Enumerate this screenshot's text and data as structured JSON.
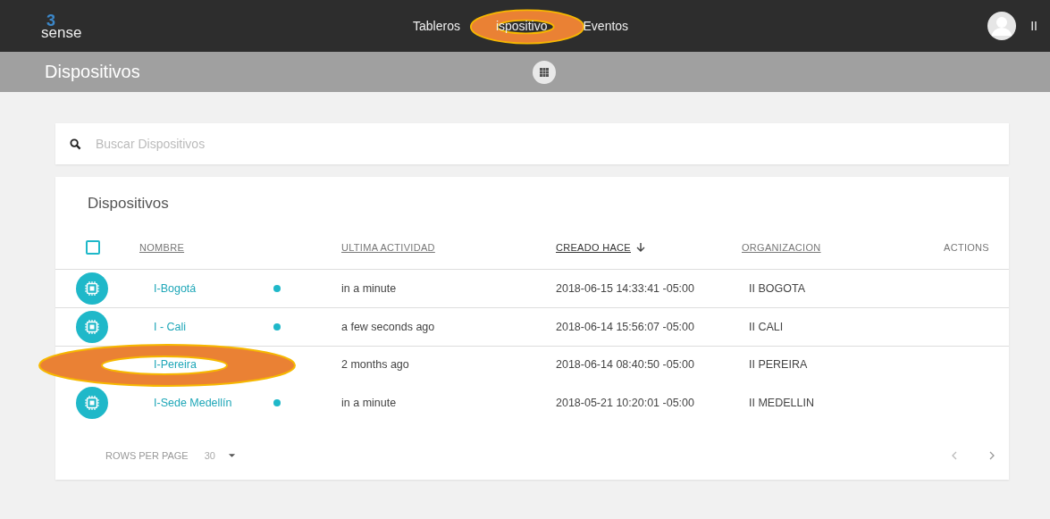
{
  "brand": {
    "logo_mark": "3",
    "logo_text": "sense"
  },
  "nav": [
    {
      "label": "Tableros",
      "annotated": false
    },
    {
      "label": "ispositivo",
      "annotated": true
    },
    {
      "label": "Eventos",
      "annotated": false
    }
  ],
  "user": {
    "name": "II"
  },
  "page_title": "Dispositivos",
  "search": {
    "placeholder": "Buscar Dispositivos"
  },
  "table": {
    "title": "Dispositivos",
    "select_all": false,
    "columns": [
      {
        "label": "NOMBRE",
        "sorted": false
      },
      {
        "label": "ULTIMA ACTIVIDAD",
        "sorted": false
      },
      {
        "label": "CREADO HACE",
        "sorted": true
      },
      {
        "label": "ORGANIZACION",
        "sorted": false
      },
      {
        "label": "ACTIONS",
        "sorted": false
      }
    ],
    "rows": [
      {
        "name": "I-Bogotá",
        "online": true,
        "annotated": false,
        "activity": "in a minute",
        "created": "2018-06-15 14:33:41 -05:00",
        "org": "II BOGOTA"
      },
      {
        "name": "I - Cali",
        "online": true,
        "annotated": false,
        "activity": "a few seconds ago",
        "created": "2018-06-14 15:56:07 -05:00",
        "org": "II CALI"
      },
      {
        "name": "I-Pereira",
        "annotated": true,
        "activity": "2 months ago",
        "created": "2018-06-14 08:40:50 -05:00",
        "org": "II PEREIRA"
      },
      {
        "name": "I-Sede Medellín",
        "online": true,
        "annotated": false,
        "activity": "in a minute",
        "created": "2018-05-21 10:20:01 -05:00",
        "org": "II MEDELLIN"
      }
    ],
    "rows_per_page_label": "ROWS PER PAGE",
    "rows_per_page": "30"
  }
}
